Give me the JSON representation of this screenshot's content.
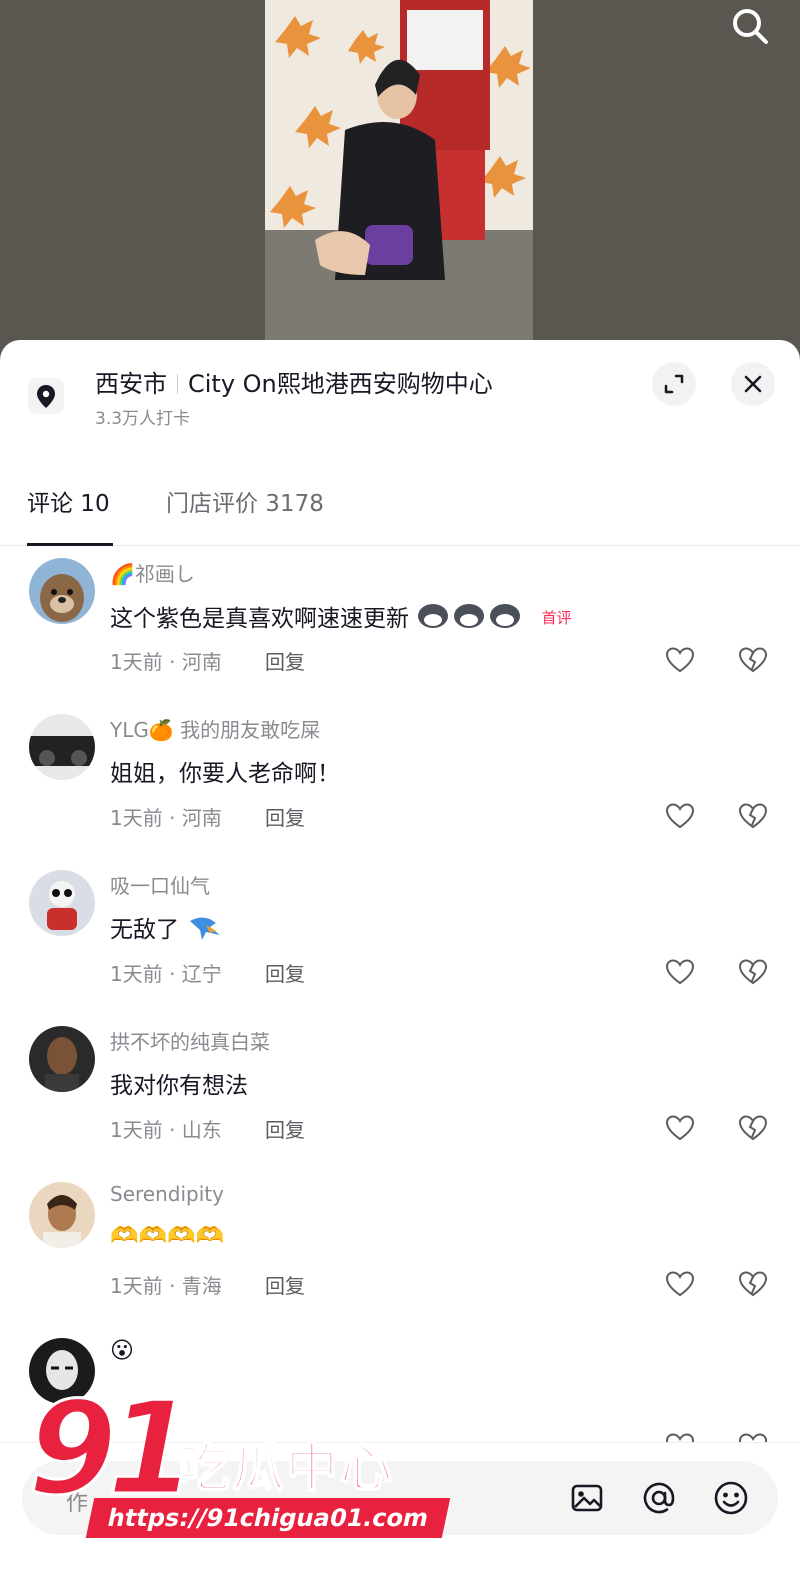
{
  "location": {
    "city": "西安市",
    "place": "City On熙地港西安购物中心",
    "checkins": "3.3万人打卡"
  },
  "tabs": [
    {
      "label": "评论 10"
    },
    {
      "label": "门店评价 3178"
    }
  ],
  "comments": [
    {
      "user": "🌈祁画し",
      "text": "这个紫色是真喜欢啊速速更新",
      "time_loc": "1天前 · 河南",
      "reply": "回复",
      "tag": "首评"
    },
    {
      "user": "YLG🍊 我的朋友敢吃屎",
      "text": "姐姐，你要人老命啊！",
      "time_loc": "1天前 · 河南",
      "reply": "回复"
    },
    {
      "user": "吸一口仙气",
      "text": "无敌了",
      "time_loc": "1天前 · 辽宁",
      "reply": "回复"
    },
    {
      "user": "拱不坏的纯真白菜",
      "text": "我对你有想法",
      "time_loc": "1天前 · 山东",
      "reply": "回复"
    },
    {
      "user": "Serendipity",
      "text": "🫶🫶🫶🫶",
      "time_loc": "1天前 · 青海",
      "reply": "回复"
    },
    {
      "user": "",
      "text": "😮",
      "time_loc": "",
      "reply": ""
    }
  ],
  "input": {
    "placeholder": "作"
  },
  "watermark": {
    "number": "91",
    "name": "吃瓜中心",
    "url": "https://91chigua01.com"
  },
  "colors": {
    "accent": "#fe2c55",
    "watermark": "#e8213f",
    "text_secondary": "#8a8b91"
  },
  "icons": [
    "search-icon",
    "location-pin-icon",
    "expand-icon",
    "close-icon",
    "heart-icon",
    "broken-heart-icon",
    "image-icon",
    "at-icon",
    "emoji-icon"
  ]
}
